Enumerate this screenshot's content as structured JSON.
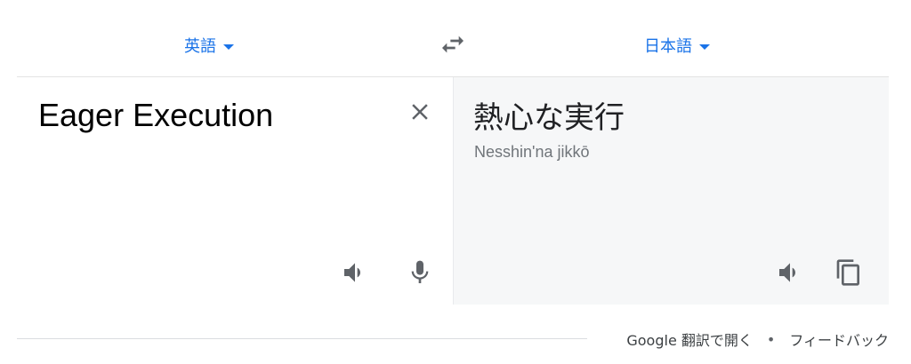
{
  "header": {
    "source_language": "英語",
    "target_language": "日本語"
  },
  "source": {
    "text": "Eager Execution"
  },
  "target": {
    "text": "熱心な実行",
    "transliteration": "Nesshin'na jikkō"
  },
  "footer": {
    "open_link": "Google 翻訳で開く",
    "separator": "•",
    "feedback_link": "フィードバック"
  },
  "icons": {
    "dropdown": "chevron-down-icon",
    "swap": "swap-icon",
    "clear": "close-icon",
    "speaker": "speaker-icon",
    "mic": "microphone-icon",
    "copy": "copy-icon"
  },
  "colors": {
    "accent": "#1a73e8",
    "target_panel": "#f6f7f8",
    "icon": "#5f6368"
  }
}
